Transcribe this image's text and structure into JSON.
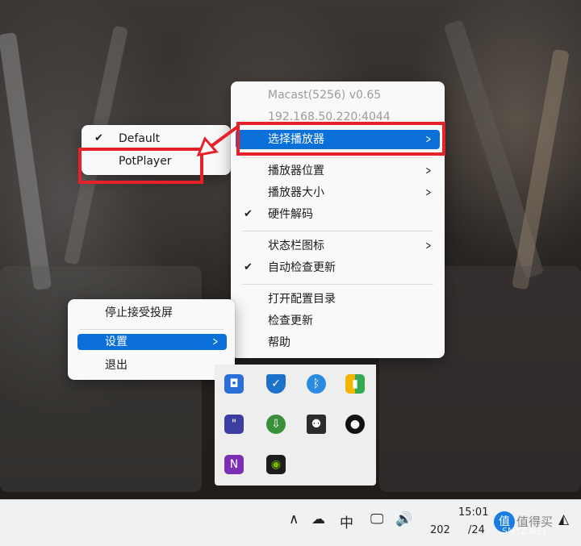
{
  "main_menu": {
    "app_info": "Macast(5256) v0.65",
    "ip_address": "192.168.50.220:4044",
    "items": [
      {
        "label": "选择播放器",
        "checked": false,
        "submenu": true
      },
      {
        "label": "播放器位置",
        "checked": false,
        "submenu": true
      },
      {
        "label": "播放器大小",
        "checked": false,
        "submenu": true
      },
      {
        "label": "硬件解码",
        "checked": true,
        "submenu": false
      },
      {
        "label": "状态栏图标",
        "checked": false,
        "submenu": true
      },
      {
        "label": "自动检查更新",
        "checked": true,
        "submenu": false
      },
      {
        "label": "打开配置目录",
        "checked": false,
        "submenu": false
      },
      {
        "label": "检查更新",
        "checked": false,
        "submenu": false
      },
      {
        "label": "帮助",
        "checked": false,
        "submenu": false
      }
    ],
    "check_glyph": "✔",
    "submenu_glyph": ">"
  },
  "player_submenu": {
    "items": [
      {
        "label": "Default",
        "checked": true
      },
      {
        "label": "PotPlayer",
        "checked": false
      }
    ]
  },
  "secondary_menu": {
    "items": [
      {
        "label": "停止接受投屏"
      },
      {
        "label": "设置",
        "submenu": true
      },
      {
        "label": "退出"
      }
    ]
  },
  "tray_overflow": {
    "icons": [
      "camera-app-icon",
      "windows-security-icon",
      "bluetooth-icon",
      "multicolor-app-icon",
      "quote-app-icon",
      "download-manager-icon",
      "film-reel-icon",
      "qq-penguin-icon",
      "onenote-icon",
      "nvidia-icon"
    ]
  },
  "taskbar": {
    "chevron": "∧",
    "ime_label": "中",
    "time": "15:01",
    "date_partial": "202",
    "date_suffix": "/24"
  },
  "watermark": {
    "brand": "值得买",
    "site": "SMYZ.NET"
  },
  "colors": {
    "highlight_red": "#e8202a",
    "selection_blue": "#0a6fd8"
  }
}
